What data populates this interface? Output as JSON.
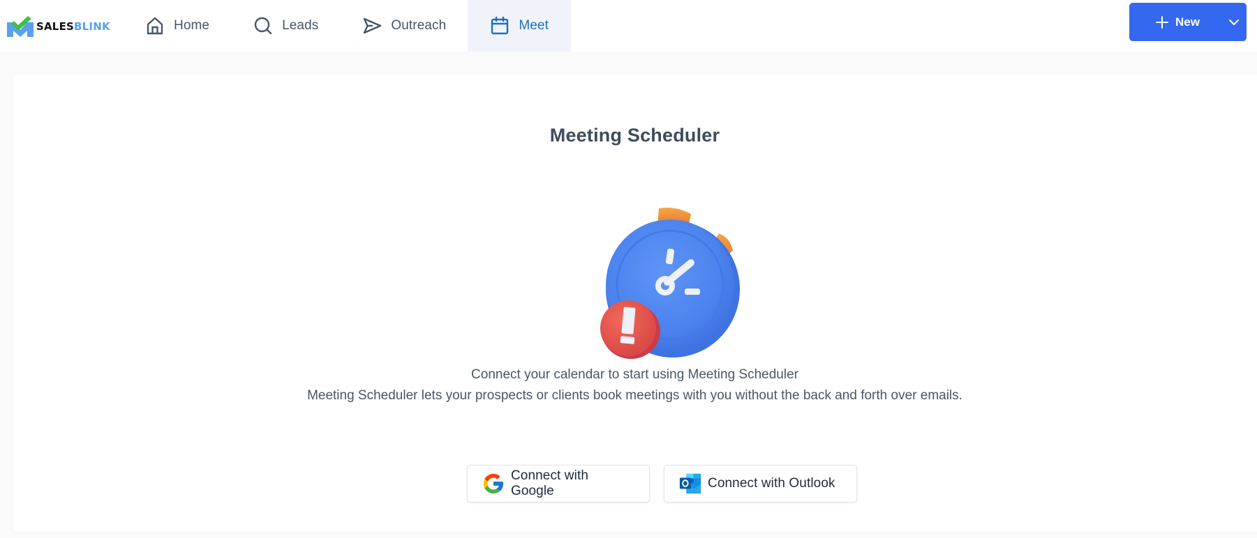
{
  "brand": {
    "name_part1": "SALES",
    "name_part2": "BLINK",
    "colors": {
      "dark": "#111111",
      "light_blue": "#5aa0f0",
      "check_green": "#3cc04a",
      "m_blue": "#5aa0f0"
    }
  },
  "nav": {
    "items": [
      {
        "label": "Home",
        "icon": "home-icon",
        "active": false
      },
      {
        "label": "Leads",
        "icon": "search-icon",
        "active": false
      },
      {
        "label": "Outreach",
        "icon": "send-icon",
        "active": false
      },
      {
        "label": "Meet",
        "icon": "calendar-icon",
        "active": true
      }
    ],
    "active_color": "#1d6fbf",
    "active_bg": "#f1f3fb"
  },
  "new_button": {
    "label": "New",
    "icon": "plus-icon",
    "dropdown_icon": "chevron-down-icon",
    "color": "#3568f0"
  },
  "main": {
    "title": "Meeting Scheduler",
    "illustration": "stopwatch-alert-illustration",
    "description_line1": "Connect your calendar to start using Meeting Scheduler",
    "description_line2": "Meeting Scheduler lets your prospects or clients book meetings with you without the back and forth over emails.",
    "buttons": [
      {
        "label": "Connect with Google",
        "icon": "google-icon"
      },
      {
        "label": "Connect with Outlook",
        "icon": "outlook-icon"
      }
    ]
  }
}
